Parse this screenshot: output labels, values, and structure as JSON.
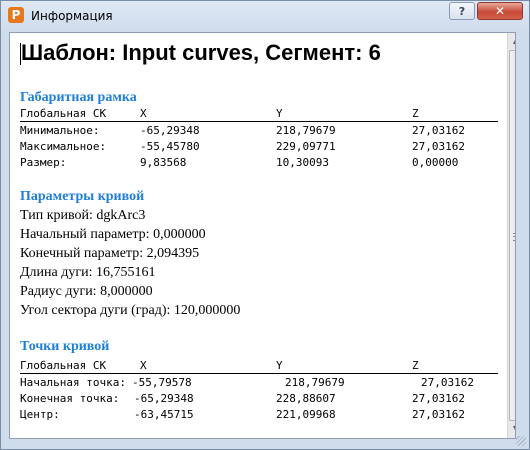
{
  "window": {
    "title": "Информация",
    "icon_glyph": "P",
    "help_label": "?",
    "close_label": "✕"
  },
  "doc_title": "Шаблон: Input curves, Сегмент: 6",
  "bbox_section": {
    "heading": "Габаритная рамка",
    "header": {
      "c0": "Глобальная СК",
      "c1": "X",
      "c2": "Y",
      "c3": "Z"
    },
    "rows": [
      {
        "label": "Минимальное:",
        "x": "-65,29348",
        "y": "218,79679",
        "z": "27,03162"
      },
      {
        "label": "Максимальное:",
        "x": "-55,45780",
        "y": "229,09771",
        "z": "27,03162"
      },
      {
        "label": "Размер:",
        "x": "9,83568",
        "y": "10,30093",
        "z": "0,00000"
      }
    ]
  },
  "curve_params": {
    "heading": "Параметры кривой",
    "lines": [
      "Тип кривой: dgkArc3",
      "Начальный параметр: 0,000000",
      "Конечный параметр: 2,094395",
      "Длина дуги: 16,755161",
      "Радиус дуги: 8,000000",
      "Угол сектора дуги (град): 120,000000"
    ]
  },
  "curve_points": {
    "heading": "Точки кривой",
    "header": {
      "c0": "Глобальная СК",
      "c1": "X",
      "c2": "Y",
      "c3": "Z"
    },
    "rows": [
      {
        "label": "Начальная точка:",
        "x": "-55,79578",
        "y": "218,79679",
        "z": "27,03162"
      },
      {
        "label": "Конечная точка:",
        "x": "-65,29348",
        "y": "228,88607",
        "z": "27,03162"
      },
      {
        "label": "Центр:",
        "x": "-63,45715",
        "y": "221,09968",
        "z": "27,03162"
      }
    ]
  },
  "colors": {
    "heading": "#1e7fd6",
    "close_button": "#c74a38"
  }
}
